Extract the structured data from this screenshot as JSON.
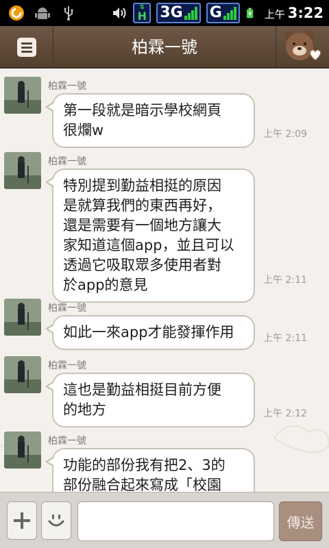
{
  "status_bar": {
    "icons": [
      "app-notification-icon",
      "android-debug-icon",
      "usb-icon",
      "volume-icon",
      "hspa-icon",
      "signal-3g-icon",
      "signal-g-icon",
      "battery-charging-icon"
    ],
    "network_3g_label": "3G",
    "network_g_label": "G",
    "hspa_label": "H",
    "ampm": "上午",
    "time": "3:22"
  },
  "header": {
    "title": "柏霖一號"
  },
  "messages": [
    {
      "sender": "柏霖一號",
      "lines": [
        "第一段就是暗示學校網頁",
        "很爛w"
      ],
      "time": "上午 2:09"
    },
    {
      "sender": "柏霖一號",
      "lines": [
        "特別提到勤益相挺的原因",
        "是就算我們的東西再好，",
        "還是需要有一個地方讓大",
        "家知道這個app，並且可以",
        "透過它吸取眾多使用者對",
        "於app的意見"
      ],
      "time": "上午 2:11"
    },
    {
      "sender": "柏霖一號",
      "lines": [
        "如此一來app才能發揮作用"
      ],
      "time": "上午 2:11"
    },
    {
      "sender": "柏霖一號",
      "lines": [
        "這也是勤益相挺目前方便",
        "的地方"
      ],
      "time": "上午 2:12"
    },
    {
      "sender": "柏霖一號",
      "lines": [
        "功能的部份我有把2、3的",
        "部份融合起來寫成「校園"
      ],
      "time": ""
    }
  ],
  "input_bar": {
    "add_label": "+",
    "placeholder": "",
    "value": "",
    "send_label": "傳送"
  },
  "colors": {
    "header_brown": "#5f4a3a",
    "chat_bg": "#f4f1ec",
    "send_button": "#a88f80"
  }
}
